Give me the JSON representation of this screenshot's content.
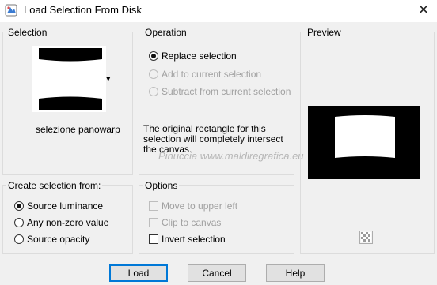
{
  "window": {
    "title": "Load Selection From Disk",
    "close_glyph": "✕",
    "app_icon": "app-icon"
  },
  "selection_group": {
    "label": "Selection",
    "file_name": "selezione panowarp",
    "dropdown_glyph": "▾"
  },
  "operation_group": {
    "label": "Operation",
    "options": [
      {
        "label": "Replace selection",
        "selected": true,
        "enabled": true
      },
      {
        "label": "Add to current selection",
        "selected": false,
        "enabled": false
      },
      {
        "label": "Subtract from current selection",
        "selected": false,
        "enabled": false
      }
    ],
    "description": "The original rectangle for this selection will completely intersect the canvas."
  },
  "preview_group": {
    "label": "Preview",
    "toggle_icon": "checkerboard-icon"
  },
  "create_group": {
    "label": "Create selection from:",
    "options": [
      {
        "label": "Source luminance",
        "selected": true
      },
      {
        "label": "Any non-zero value",
        "selected": false
      },
      {
        "label": "Source opacity",
        "selected": false
      }
    ]
  },
  "options_group": {
    "label": "Options",
    "items": [
      {
        "label": "Move to upper left",
        "checked": false,
        "enabled": false
      },
      {
        "label": "Clip to canvas",
        "checked": false,
        "enabled": false
      },
      {
        "label": "Invert selection",
        "checked": false,
        "enabled": true
      }
    ]
  },
  "buttons": {
    "load": "Load",
    "cancel": "Cancel",
    "help": "Help"
  },
  "watermark": {
    "text": "Pinuccia  www.maldiregrafica.eu"
  },
  "colors": {
    "accent": "#0078d7",
    "preview_bg": "#000000",
    "preview_shape": "#ffffff"
  }
}
